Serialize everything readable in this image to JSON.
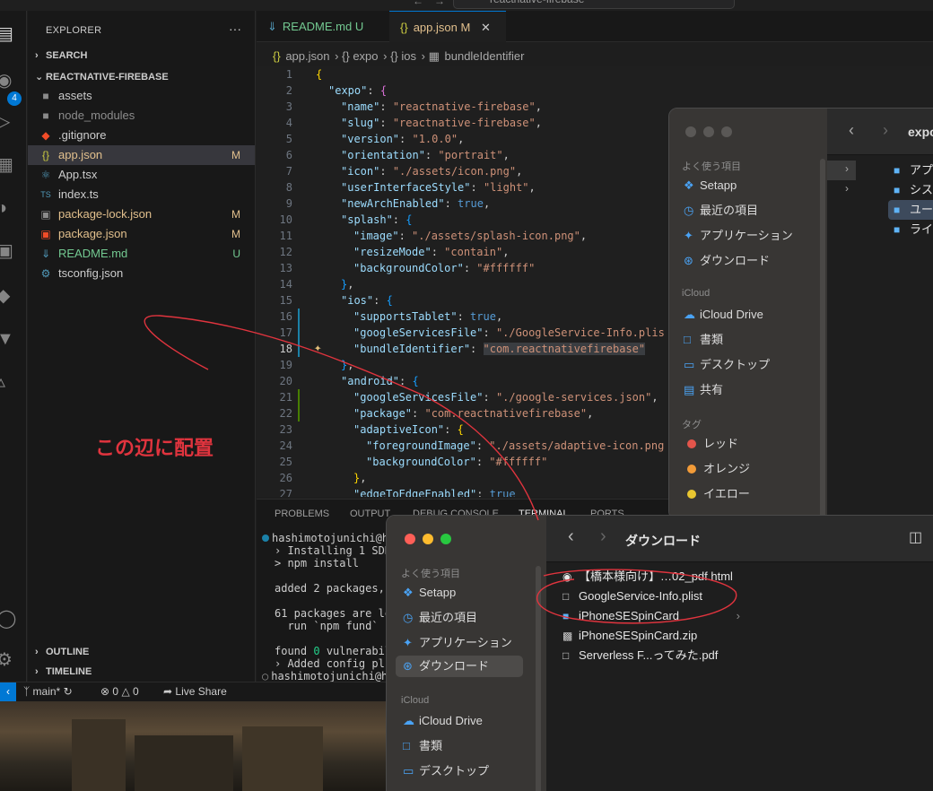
{
  "titlebar": {
    "search": "reactnative-firebase"
  },
  "activity": {
    "badge": "4"
  },
  "explorer": {
    "title": "EXPLORER",
    "more": "···",
    "sections": {
      "search": "SEARCH",
      "project": "REACTNATIVE-FIREBASE",
      "outline": "OUTLINE",
      "timeline": "TIMELINE"
    },
    "files": [
      {
        "name": "assets",
        "status": ""
      },
      {
        "name": "node_modules",
        "status": ""
      },
      {
        "name": ".gitignore",
        "status": ""
      },
      {
        "name": "app.json",
        "status": "M"
      },
      {
        "name": "App.tsx",
        "status": ""
      },
      {
        "name": "index.ts",
        "status": ""
      },
      {
        "name": "package-lock.json",
        "status": "M"
      },
      {
        "name": "package.json",
        "status": "M"
      },
      {
        "name": "README.md",
        "status": "U"
      },
      {
        "name": "tsconfig.json",
        "status": ""
      }
    ]
  },
  "annotation": "この辺に配置",
  "tabs": [
    {
      "label": "README.md",
      "status": "U"
    },
    {
      "label": "app.json",
      "status": "M"
    }
  ],
  "breadcrumb": [
    "app.json",
    "{} expo",
    "{} ios",
    "bundleIdentifier"
  ],
  "code": {
    "line_numbers": [
      "1",
      "2",
      "3",
      "4",
      "5",
      "6",
      "7",
      "8",
      "9",
      "10",
      "11",
      "12",
      "13",
      "14",
      "15",
      "16",
      "17",
      "18",
      "19",
      "20",
      "21",
      "22",
      "23",
      "24",
      "25",
      "26",
      "27"
    ],
    "keys": {
      "expo": "\"expo\"",
      "name": "\"name\"",
      "slug": "\"slug\"",
      "version": "\"version\"",
      "orientation": "\"orientation\"",
      "icon": "\"icon\"",
      "uiStyle": "\"userInterfaceStyle\"",
      "newArch": "\"newArchEnabled\"",
      "splash": "\"splash\"",
      "image": "\"image\"",
      "resizeMode": "\"resizeMode\"",
      "backgroundColor": "\"backgroundColor\"",
      "ios": "\"ios\"",
      "supportsTablet": "\"supportsTablet\"",
      "googleServicesFile": "\"googleServicesFile\"",
      "bundleIdentifier": "\"bundleIdentifier\"",
      "android": "\"android\"",
      "package": "\"package\"",
      "adaptiveIcon": "\"adaptiveIcon\"",
      "foregroundImage": "\"foregroundImage\"",
      "edgeToEdge": "\"edgeToEdgeEnabled\""
    },
    "values": {
      "name": "\"reactnative-firebase\"",
      "slug": "\"reactnative-firebase\"",
      "version": "\"1.0.0\"",
      "orientation": "\"portrait\"",
      "icon": "\"./assets/icon.png\"",
      "uiStyle": "\"light\"",
      "true": "true",
      "splashImage": "\"./assets/splash-icon.png\"",
      "resizeMode": "\"contain\"",
      "bg": "\"#ffffff\"",
      "iosGoogle": "\"./GoogleService-Info.plis",
      "bundleId": "\"com.reactnativefirebase\"",
      "androidGoogle": "\"./google-services.json\"",
      "package": "\"com.reactnativefirebase\"",
      "fgImage": "\"./assets/adaptive-icon.png",
      "adaptiveBg": "\"#ffffff\"",
      "edgeTrue": "true"
    }
  },
  "panel": {
    "tabs": [
      "PROBLEMS",
      "OUTPUT",
      "DEBUG CONSOLE",
      "TERMINAL",
      "PORTS"
    ],
    "terminal": [
      "hashimotojunichi@h",
      "› Installing 1 SDK",
      "> npm install",
      "",
      "added 2 packages,",
      "",
      "61 packages are lo",
      "  run `npm fund` f",
      "",
      "found ",
      "› Added config plu",
      "hashimotojunichi@h"
    ],
    "found_count": "0",
    "found_rest": " vulnerabil"
  },
  "status": {
    "branch": "main*",
    "errors": "0",
    "warnings": "0",
    "live_share": "Live Share"
  },
  "finder_back": {
    "groups": {
      "favorites": "よく使う項目",
      "icloud": "iCloud",
      "tags": "タグ"
    },
    "items": [
      "Setapp",
      "最近の項目",
      "アプリケーション",
      "ダウンロード"
    ],
    "icloud_items": [
      "iCloud Drive",
      "書類",
      "デスクトップ",
      "共有"
    ],
    "tags": [
      {
        "label": "レッド",
        "color": "#e3554b"
      },
      {
        "label": "オレンジ",
        "color": "#f29b38"
      },
      {
        "label": "イエロー",
        "color": "#e9c630"
      }
    ],
    "title": "expo",
    "columns": [
      "アプ",
      "シス",
      "ユー",
      "ライ"
    ]
  },
  "finder_front": {
    "title": "ダウンロード",
    "groups": {
      "favorites": "よく使う項目",
      "icloud": "iCloud"
    },
    "items": [
      "Setapp",
      "最近の項目",
      "アプリケーション",
      "ダウンロード"
    ],
    "icloud_items": [
      "iCloud Drive",
      "書類",
      "デスクトップ"
    ],
    "files": [
      "【橋本様向け】…02_pdf.html",
      "GoogleService-Info.plist",
      "iPhoneSESpinCard",
      "iPhoneSESpinCard.zip",
      "Serverless F...ってみた.pdf"
    ]
  }
}
